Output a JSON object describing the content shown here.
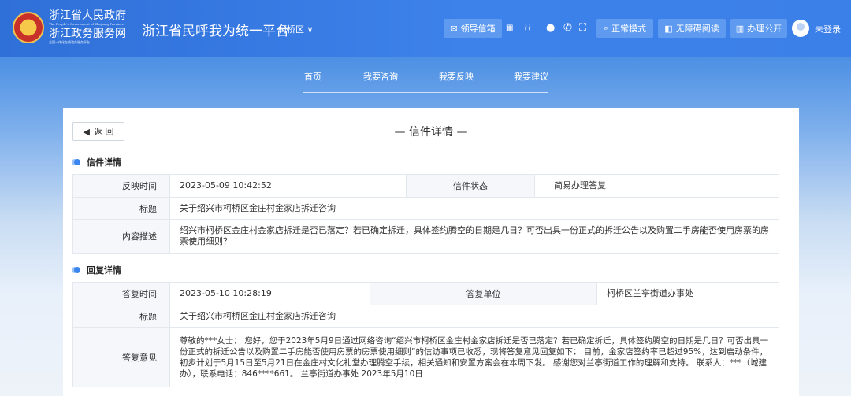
{
  "header": {
    "gov_name": "浙江省人民政府",
    "gov_name_en": "The People's Government of Zhejiang Province",
    "service_name": "浙江政务服务网",
    "service_sub": "全国一体化在线政务服务平台",
    "platform_title": "浙江省民呼我为统一平台",
    "region": "柯桥区",
    "leader_mailbox": "领导信箱",
    "normal_mode": "正常模式",
    "accessible_read": "无障碍阅读",
    "handling_public": "办理公开",
    "login": "未登录"
  },
  "nav": {
    "items": [
      "首页",
      "我要咨询",
      "我要反映",
      "我要建议"
    ]
  },
  "card": {
    "back_label": "返 回",
    "title": "信件详情"
  },
  "letter": {
    "section_title": "信件详情",
    "time_label": "反映时间",
    "time_value": "2023-05-09 10:42:52",
    "status_label": "信件状态",
    "status_value": "简易办理答复",
    "title_label": "标题",
    "title_value": "关于绍兴市柯桥区金庄村金家店拆迁咨询",
    "content_label": "内容描述",
    "content_value": "绍兴市柯桥区金庄村金家店拆迁是否已落定？若已确定拆迁，具体签约腾空的日期是几日？可否出具一份正式的拆迁公告以及购置二手房能否使用房票的房票使用细则？"
  },
  "reply": {
    "section_title": "回复详情",
    "time_label": "答复时间",
    "time_value": "2023-05-10 10:28:19",
    "unit_label": "答复单位",
    "unit_value": "柯桥区兰亭街道办事处",
    "title_label": "标题",
    "title_value": "关于绍兴市柯桥区金庄村金家店拆迁咨询",
    "opinion_label": "答复意见",
    "opinion_value": "尊敬的***女士：  您好，您于2023年5月9日通过网络咨询“绍兴市柯桥区金庄村金家店拆迁是否已落定？若已确定拆迁，具体签约腾空的日期是几日？可否出具一份正式的拆迁公告以及购置二手房能否使用房票的房票使用细则”的信访事项已收悉，现将答复意见回复如下：  目前，金家店签约率已超过95%，达到启动条件，初步计划于5月15日至5月21日在金庄村文化礼堂办理腾空手续，相关通知和安置方案会在本周下发。 感谢您对兰亭街道工作的理解和支持。 联系人：***（城建办），联系电话：846****661。 兰亭街道办事处 2023年5月10日"
  },
  "colors": {
    "header": "#3d82ea",
    "button": "#5d9af0",
    "accent": "#3b85ee"
  }
}
